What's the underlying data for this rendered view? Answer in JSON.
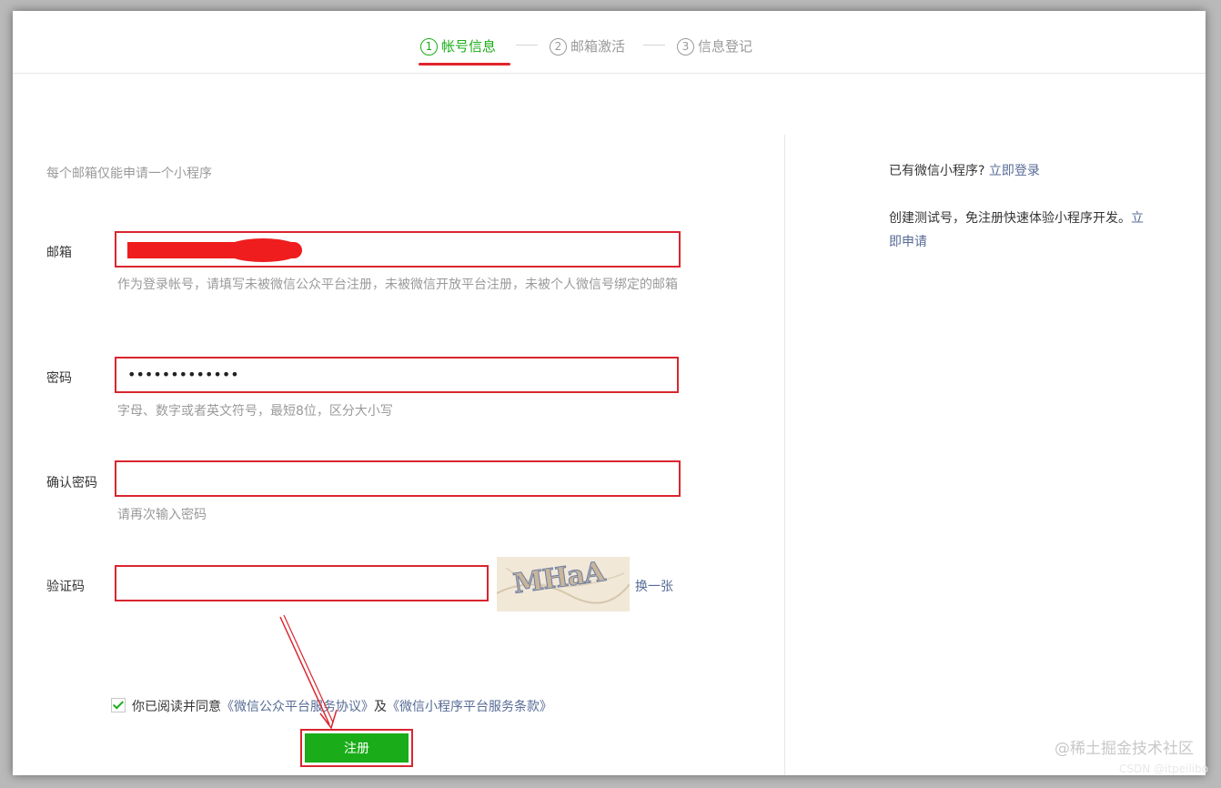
{
  "steps": [
    {
      "num": "1",
      "label": "帐号信息"
    },
    {
      "num": "2",
      "label": "邮箱激活"
    },
    {
      "num": "3",
      "label": "信息登记"
    }
  ],
  "form": {
    "tip": "每个邮箱仅能申请一个小程序",
    "email": {
      "label": "邮箱",
      "help": "作为登录帐号，请填写未被微信公众平台注册，未被微信开放平台注册，未被个人微信号绑定的邮箱"
    },
    "password": {
      "label": "密码",
      "value": "•••••••••••••",
      "help": "字母、数字或者英文符号，最短8位，区分大小写"
    },
    "confirm": {
      "label": "确认密码",
      "help": "请再次输入密码"
    },
    "captcha": {
      "label": "验证码",
      "image_text": "MHaA",
      "refresh": "换一张"
    },
    "agree": {
      "prefix": "你已阅读并同意",
      "link1": "《微信公众平台服务协议》",
      "middle": "及",
      "link2": "《微信小程序平台服务条款》"
    },
    "submit": "注册"
  },
  "sidebar": {
    "has_account": "已有微信小程序?",
    "login_link": "立即登录",
    "test_text": "创建测试号，免注册快速体验小程序开发。",
    "apply_link": "立即申请"
  },
  "watermark": {
    "main": "@稀土掘金技术社区",
    "sub": "CSDN @itpeilibo"
  },
  "colors": {
    "accent": "#1aad19",
    "link": "#576b95",
    "highlight": "#d9262f"
  }
}
